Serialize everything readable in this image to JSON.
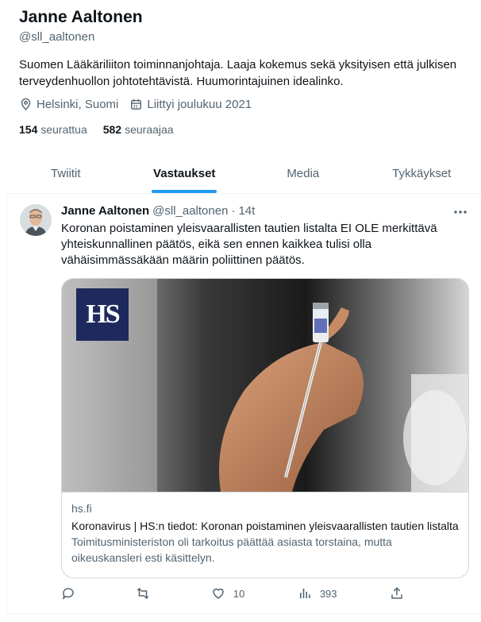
{
  "profile": {
    "name": "Janne Aaltonen",
    "handle": "@sll_aaltonen",
    "bio": "Suomen Lääkäriliiton toiminnanjohtaja. Laaja kokemus sekä yksityisen että julkisen terveydenhuollon johtotehtävistä. Huumorintajuinen idealinko.",
    "location": "Helsinki, Suomi",
    "joined": "Liittyi joulukuu 2021",
    "following_count": "154",
    "following_label": "seurattua",
    "followers_count": "582",
    "followers_label": "seuraajaa"
  },
  "tabs": [
    {
      "label": "Twiitit",
      "active": false
    },
    {
      "label": "Vastaukset",
      "active": true
    },
    {
      "label": "Media",
      "active": false
    },
    {
      "label": "Tykkäykset",
      "active": false
    }
  ],
  "tweet": {
    "author_name": "Janne Aaltonen",
    "author_handle": "@sll_aaltonen",
    "separator": "·",
    "time": "14t",
    "text": "Koronan poistaminen yleisvaarallisten tautien listalta EI OLE merkittävä yhteiskunnallinen päätös, eikä sen ennen kaikkea tulisi olla vähäisimmässäkään määrin poliittinen päätös.",
    "card": {
      "logo_text": "HS",
      "domain": "hs.fi",
      "title": "Koronavirus | HS:n tiedot: Koronan poistaminen yleisvaarallisten tautien listalta",
      "description": "Toimitusministeriston oli tarkoitus päättää asiasta torstaina, mutta oikeuskansleri esti käsittelyn."
    },
    "actions": {
      "reply_count": "",
      "retweet_count": "",
      "like_count": "10",
      "views_count": "393"
    }
  },
  "colors": {
    "accent": "#1d9bf0",
    "text_primary": "#0f1419",
    "text_secondary": "#536471",
    "hs_logo_bg": "#1e2a5e"
  }
}
